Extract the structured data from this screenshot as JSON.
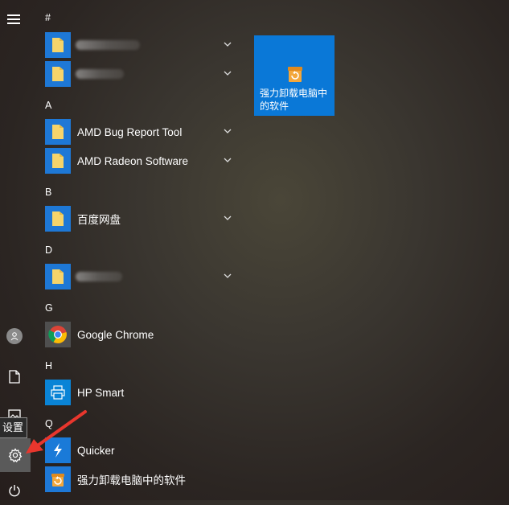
{
  "rail": {
    "tooltip": "设置"
  },
  "letters": [
    "#",
    "A",
    "B",
    "D",
    "G",
    "H",
    "Q"
  ],
  "apps": [
    {
      "label": "",
      "obscured": true
    },
    {
      "label": "",
      "obscured": true
    },
    {
      "label": "AMD Bug Report Tool"
    },
    {
      "label": "AMD Radeon Software"
    },
    {
      "label": "百度网盘"
    },
    {
      "label": "",
      "obscured": true
    },
    {
      "label": "Google Chrome"
    },
    {
      "label": "HP Smart"
    },
    {
      "label": "Quicker"
    },
    {
      "label": "强力卸载电脑中的软件"
    }
  ],
  "tile": {
    "label": "强力卸载电脑中的软件"
  },
  "colors": {
    "tile_blue": "#0a78d7",
    "folder_yellow": "#f6d46a",
    "arrow_red": "#e8362d"
  }
}
